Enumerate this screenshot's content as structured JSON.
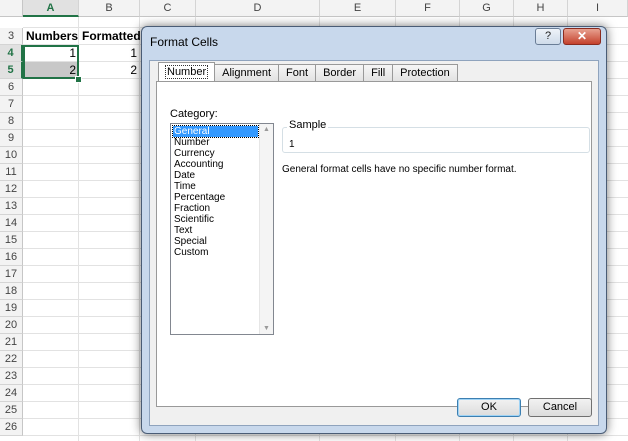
{
  "spreadsheet": {
    "columns": [
      "A",
      "B",
      "C",
      "D",
      "E",
      "F",
      "G",
      "H",
      "I"
    ],
    "rows": [
      "3",
      "4",
      "5",
      "6",
      "7",
      "8",
      "9",
      "10",
      "11",
      "12",
      "13",
      "14",
      "15",
      "16",
      "17",
      "18",
      "19",
      "20",
      "21",
      "22",
      "23",
      "24",
      "25",
      "26"
    ],
    "selected_column": "A",
    "selected_rows": [
      "4",
      "5"
    ],
    "cells": {
      "A3": "Numbers",
      "B3": "Formatted",
      "A4": "1",
      "B4": "1",
      "A5": "2",
      "B5": "2"
    }
  },
  "dialog": {
    "title": "Format Cells",
    "help_label": "?",
    "close_label": "✕",
    "tabs": [
      "Number",
      "Alignment",
      "Font",
      "Border",
      "Fill",
      "Protection"
    ],
    "active_tab": "Number",
    "category_label": "Category:",
    "categories": [
      "General",
      "Number",
      "Currency",
      "Accounting",
      "Date",
      "Time",
      "Percentage",
      "Fraction",
      "Scientific",
      "Text",
      "Special",
      "Custom"
    ],
    "selected_category": "General",
    "sample_label": "Sample",
    "sample_value": "1",
    "description": "General format cells have no specific number format.",
    "ok_label": "OK",
    "cancel_label": "Cancel"
  },
  "colors": {
    "excel_green": "#217346",
    "selection_blue": "#3399ff",
    "close_red": "#c4412c"
  }
}
